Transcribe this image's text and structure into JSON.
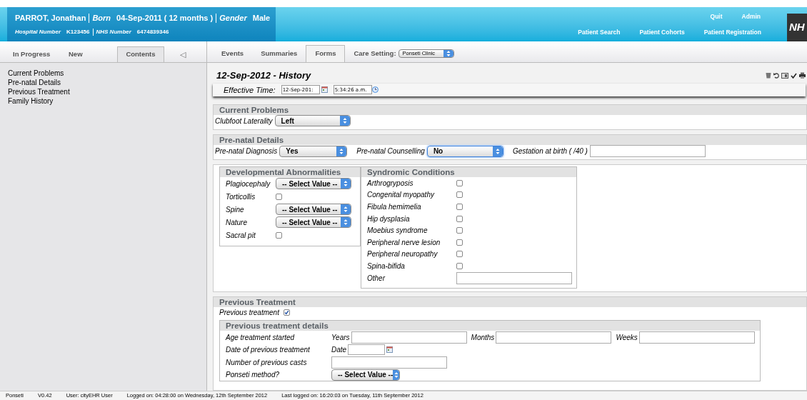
{
  "header": {
    "name": "PARROT, Jonathan",
    "born_label": "Born",
    "born_value": "04-Sep-2011 ( 12 months )",
    "gender_label": "Gender",
    "gender_value": "Male",
    "hospital_label": "Hospital Number",
    "hospital_value": "K123456",
    "nhs_label": "NHS Number",
    "nhs_value": "6474839346",
    "top_links": [
      "Quit",
      "Admin"
    ],
    "nav_links": [
      "Patient Search",
      "Patient Cohorts",
      "Patient Registration"
    ],
    "logo": "NH"
  },
  "left_tabs": [
    {
      "label": "In Progress",
      "selected": false
    },
    {
      "label": "New",
      "selected": false
    },
    {
      "label": "Contents",
      "selected": true
    }
  ],
  "collapse": "◁",
  "contents": [
    "Current Problems",
    "Pre-natal Details",
    "Previous Treatment",
    "Family History"
  ],
  "main_tabs": [
    {
      "label": "Events",
      "selected": false
    },
    {
      "label": "Summaries",
      "selected": false
    },
    {
      "label": "Forms",
      "selected": true
    }
  ],
  "care_setting": {
    "label": "Care Setting:",
    "value": "Ponseti Clinic"
  },
  "form": {
    "title": "12-Sep-2012 - History",
    "effective_label": "Effective Time:",
    "date": "12-Sep-201:",
    "time": "5:34:26 a.m."
  },
  "current_problems": {
    "title": "Current Problems",
    "fields": [
      {
        "label": "Clubfoot Laterality",
        "kind": "select",
        "value": "Left"
      }
    ]
  },
  "prenatal": {
    "title": "Pre-natal Details",
    "fields": [
      {
        "label": "Pre-natal Diagnosis",
        "kind": "select",
        "value": "Yes",
        "focused": false
      },
      {
        "label": "Pre-natal Counselling",
        "kind": "select",
        "value": "No",
        "focused": true
      },
      {
        "label": "Gestation at birth ( /40 )",
        "kind": "text"
      }
    ]
  },
  "developmental": {
    "title": "Developmental Abnormalities",
    "fields": [
      {
        "label": "Plagiocephaly",
        "kind": "select",
        "value": "-- Select Value --"
      },
      {
        "label": "Torticollis",
        "kind": "checkbox",
        "checked": false
      },
      {
        "label": "Spine",
        "kind": "select",
        "value": "-- Select Value --"
      },
      {
        "label": "Nature",
        "kind": "select",
        "value": "-- Select Value --"
      },
      {
        "label": "Sacral pit",
        "kind": "checkbox",
        "checked": false
      }
    ]
  },
  "syndromic": {
    "title": "Syndromic Conditions",
    "fields": [
      {
        "label": "Arthrogryposis",
        "kind": "checkbox",
        "checked": false
      },
      {
        "label": "Congenital myopathy",
        "kind": "checkbox",
        "checked": false
      },
      {
        "label": "Fibula hemimelia",
        "kind": "checkbox",
        "checked": false
      },
      {
        "label": "Hip dysplasia",
        "kind": "checkbox",
        "checked": false
      },
      {
        "label": "Moebius syndrome",
        "kind": "checkbox",
        "checked": false
      },
      {
        "label": "Peripheral nerve lesion",
        "kind": "checkbox",
        "checked": false
      },
      {
        "label": "Peripheral neuropathy",
        "kind": "checkbox",
        "checked": false
      },
      {
        "label": "Spina-bifida",
        "kind": "checkbox",
        "checked": false
      },
      {
        "label": "Other",
        "kind": "text"
      }
    ]
  },
  "previous_treatment": {
    "title": "Previous Treatment",
    "fields": [
      {
        "label": "Previous treatment",
        "kind": "checkbox",
        "checked": true
      }
    ],
    "details": {
      "title": "Previous treatment details",
      "rows": [
        {
          "label": "Age treatment started",
          "parts": [
            {
              "label": "Years",
              "kind": "text"
            },
            {
              "label": "Months",
              "kind": "text"
            },
            {
              "label": "Weeks",
              "kind": "text"
            }
          ]
        },
        {
          "label": "Date of previous treatment",
          "parts": [
            {
              "label": "Date",
              "kind": "date"
            }
          ]
        },
        {
          "label": "Number of previous casts",
          "parts": [
            {
              "kind": "text"
            }
          ]
        },
        {
          "label": "Ponseti method?",
          "parts": [
            {
              "kind": "select",
              "value": "-- Select Value --"
            }
          ]
        }
      ]
    }
  },
  "status_bar": [
    "Ponseti",
    "V0.42",
    "User: cityEHR User",
    "Logged on: 04:28:00 on Wednesday, 12th September 2012",
    "Last logged on: 16:20:03 on Tuesday, 11th September 2012"
  ]
}
